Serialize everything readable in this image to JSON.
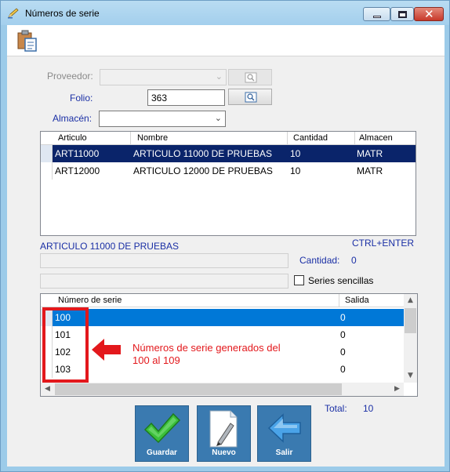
{
  "window": {
    "title": "Números de serie",
    "title_icon": "pencil-icon",
    "controls": [
      "minimize-icon",
      "maximize-icon",
      "close-icon"
    ]
  },
  "toolbar": {
    "icon": "clipboard-icon"
  },
  "form": {
    "proveedor": {
      "label": "Proveedor:",
      "value": "",
      "enabled": false
    },
    "folio": {
      "label": "Folio:",
      "value": "363"
    },
    "almacen": {
      "label": "Almacén:",
      "value": ""
    }
  },
  "articles_table": {
    "columns": [
      "Articulo",
      "Nombre",
      "Cantidad",
      "Almacen"
    ],
    "rows": [
      {
        "articulo": "ART11000",
        "nombre": "ARTICULO 11000 DE PRUEBAS",
        "cantidad": "10",
        "almacen": "MATR",
        "selected": true
      },
      {
        "articulo": "ART12000",
        "nombre": "ARTICULO 12000 DE PRUEBAS",
        "cantidad": "10",
        "almacen": "MATR",
        "selected": false
      }
    ]
  },
  "selected_article": {
    "name": "ARTICULO 11000 DE PRUEBAS",
    "shortcut": "CTRL+ENTER",
    "cantidad_label": "Cantidad:",
    "cantidad_value": "0",
    "series_sencillas_label": "Series sencillas",
    "series_sencillas_checked": false
  },
  "serials_table": {
    "columns": [
      "Número de serie",
      "Salida"
    ],
    "rows": [
      {
        "serie": "100",
        "salida": "0",
        "selected": true
      },
      {
        "serie": "101",
        "salida": "0",
        "selected": false
      },
      {
        "serie": "102",
        "salida": "0",
        "selected": false
      },
      {
        "serie": "103",
        "salida": "0",
        "selected": false
      }
    ]
  },
  "total": {
    "label": "Total:",
    "value": "10"
  },
  "buttons": {
    "guardar": {
      "label": "Guardar",
      "icon": "checkmark-icon"
    },
    "nuevo": {
      "label": "Nuevo",
      "icon": "document-pen-icon"
    },
    "salir": {
      "label": "Salir",
      "icon": "arrow-left-icon"
    }
  },
  "annotation": {
    "line1": "Números de serie generados del",
    "line2": "100 al 109",
    "color": "#e3181c"
  },
  "colors": {
    "selected_row_dark": "#0a246a",
    "selected_row_blue": "#0078d7",
    "label_blue": "#1a2fa5",
    "action_button": "#3a7ab0"
  }
}
